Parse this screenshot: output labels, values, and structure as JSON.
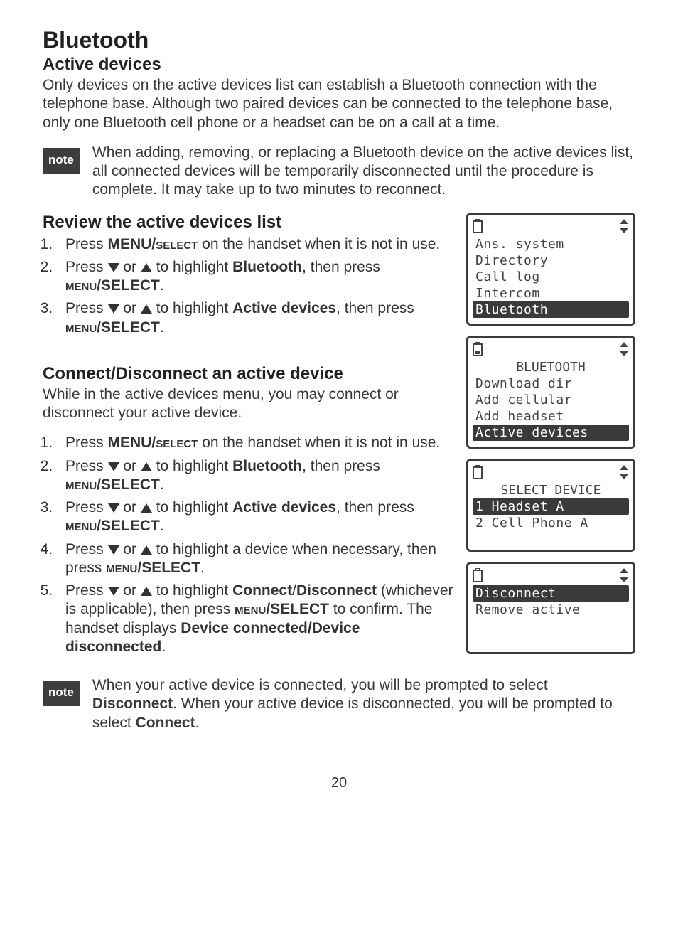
{
  "title": "Bluetooth",
  "s1": {
    "heading": "Active devices",
    "para": "Only devices on the active devices list can establish a Bluetooth connection with the telephone base. Although two paired devices can be connected to the telephone base, only one Bluetooth cell phone or a headset can be on a call at a time."
  },
  "note1": {
    "label": "note",
    "text": "When adding, removing, or replacing a Bluetooth device on the active devices list, all connected devices will be temporarily disconnected until the procedure is complete. It may take up to two minutes to reconnect."
  },
  "s2": {
    "heading": "Review the active devices list",
    "step1a": "Press ",
    "step1b": "MENU/",
    "step1c": "select",
    "step1d": " on the handset when it is not in use.",
    "step2a": "Press ",
    "step2b": " or ",
    "step2c": " to highlight ",
    "step2d": "Bluetooth",
    "step2e": ", then press ",
    "step2f": "menu",
    "step2g": "/SELECT",
    "step2h": ".",
    "step3a": "Press ",
    "step3b": " or ",
    "step3c": " to highlight ",
    "step3d": "Active devices",
    "step3e": ", then press ",
    "step3f": "menu",
    "step3g": "/SELECT",
    "step3h": "."
  },
  "s3": {
    "heading": "Connect/Disconnect an active device",
    "para": "While in the active devices menu, you may connect or disconnect your active device.",
    "step1a": "Press ",
    "step1b": "MENU/",
    "step1c": "select",
    "step1d": " on the handset when it is not in use.",
    "step2a": "Press ",
    "step2b": " or ",
    "step2c": " to highlight ",
    "step2d": "Bluetooth",
    "step2e": ", then press ",
    "step2f": "menu",
    "step2g": "/SELECT",
    "step2h": ".",
    "step3a": "Press ",
    "step3b": " or ",
    "step3c": " to highlight ",
    "step3d": "Active devices",
    "step3e": ", then press ",
    "step3f": "menu",
    "step3g": "/SELECT",
    "step3h": ".",
    "step4a": "Press ",
    "step4b": " or ",
    "step4c": " to highlight a device when necessary, then press ",
    "step4d": "menu",
    "step4e": "/SELECT",
    "step4f": ".",
    "step5a": "Press ",
    "step5b": " or ",
    "step5c": " to highlight ",
    "step5d": "Connect",
    "step5e": "/",
    "step5f": "Disconnect",
    "step5g": " (whichever is applicable), then press ",
    "step5h": "menu",
    "step5i": "/SELECT",
    "step5j": " to confirm. The handset displays ",
    "step5k": "Device connected/Device disconnected",
    "step5l": "."
  },
  "note2": {
    "label": "note",
    "t1": "When your active device is connected, you will be prompted to select ",
    "t2": "Disconnect",
    "t3": ". When your active device is disconnected, you will be prompted to select ",
    "t4": "Connect",
    "t5": "."
  },
  "screens": {
    "scr1": {
      "l1": "Ans. system",
      "l2": "Directory",
      "l3": "Call log",
      "l4": "Intercom",
      "l5": "Bluetooth"
    },
    "scr2": {
      "title": "BLUETOOTH",
      "l1": "Download dir",
      "l2": "Add cellular",
      "l3": "Add headset",
      "l4": "Active devices"
    },
    "scr3": {
      "title": "SELECT DEVICE",
      "l1": "1 Headset A",
      "l2": "2 Cell Phone A"
    },
    "scr4": {
      "l1": "Disconnect",
      "l2": "Remove active"
    }
  },
  "pageNumber": "20"
}
